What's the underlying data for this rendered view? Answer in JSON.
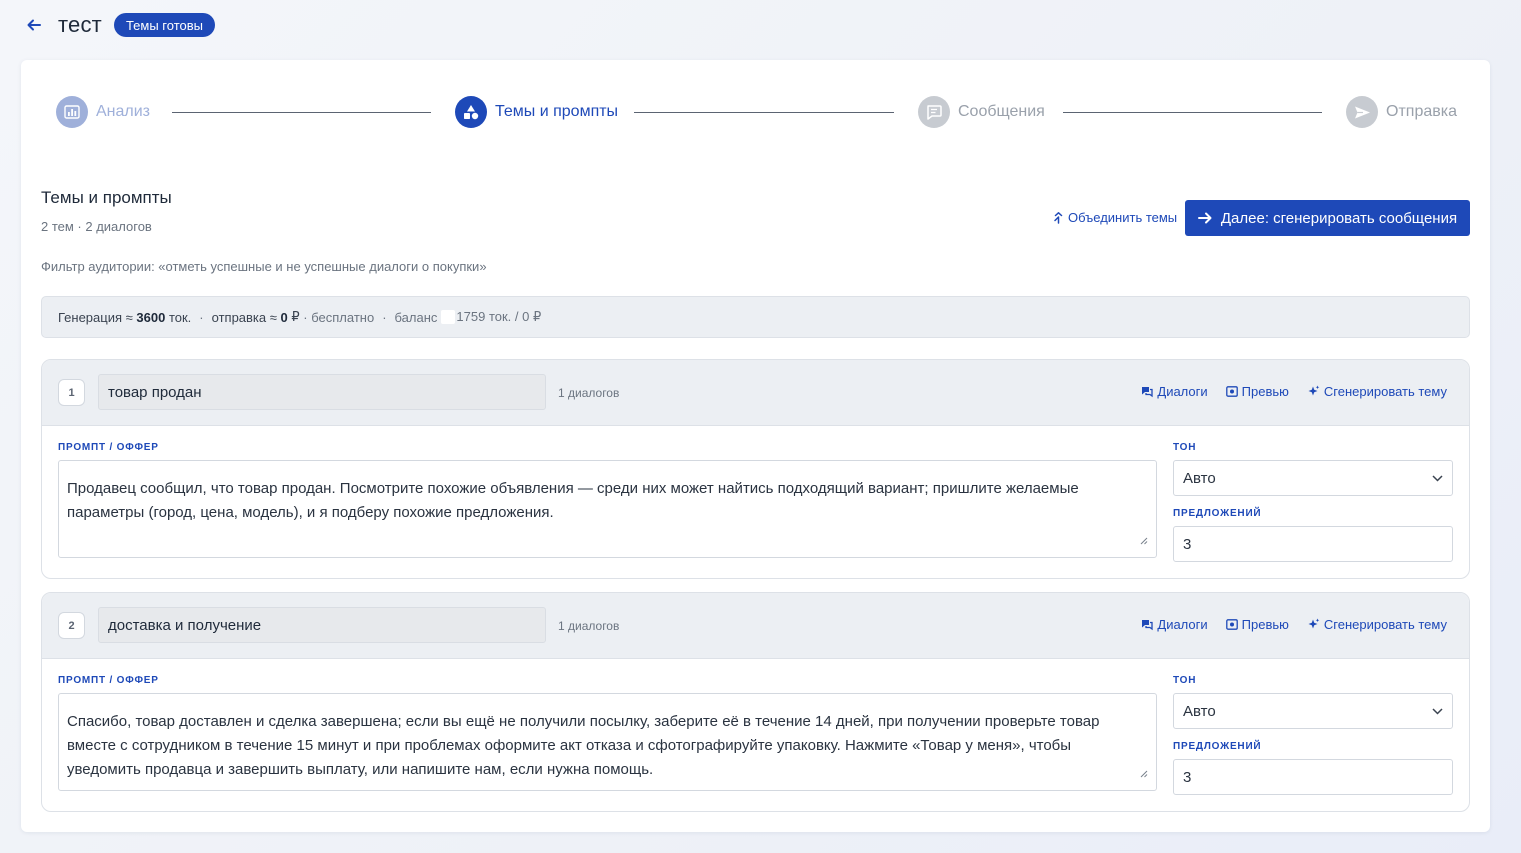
{
  "header": {
    "title": "тест",
    "status_badge": "Темы готовы"
  },
  "steps": [
    {
      "label": "Анализ",
      "state": "done"
    },
    {
      "label": "Темы и промпты",
      "state": "active"
    },
    {
      "label": "Сообщения",
      "state": "pending"
    },
    {
      "label": "Отправка",
      "state": "pending"
    }
  ],
  "section": {
    "title": "Темы и промпты",
    "subtitle": "2 тем · 2 диалогов",
    "filter": "Фильтр аудитории: «отметь успешные и не успешные диалоги о покупки»",
    "merge_label": "Объединить темы",
    "next_label": "Далее: сгенерировать сообщения"
  },
  "cost": {
    "gen_prefix": "Генерация ≈",
    "gen_value": "3600",
    "gen_unit": "ток.",
    "send_prefix": "отправка ≈",
    "send_value": "0",
    "send_unit": "₽",
    "free": "· бесплатно",
    "balance_label": "баланс",
    "balance_value": "1759 ток. / 0 ₽"
  },
  "labels": {
    "prompt": "ПРОМПТ / ОФФЕР",
    "tone": "ТОН",
    "sentences": "ПРЕДЛОЖЕНИЙ",
    "dialogs": "Диалоги",
    "preview": "Превью",
    "generate": "Сгенерировать тему"
  },
  "topics": [
    {
      "num": "1",
      "name": "товар продан",
      "count": "1 диалогов",
      "prompt": "Продавец сообщил, что товар продан. Посмотрите похожие объявления — среди них может найтись подходящий вариант; пришлите желаемые параметры (город, цена, модель), и я подберу похожие предложения.",
      "tone": "Авто",
      "sentences": "3"
    },
    {
      "num": "2",
      "name": "доставка и получение",
      "count": "1 диалогов",
      "prompt": "Спасибо, товар доставлен и сделка завершена; если вы ещё не получили посылку, заберите её в течение 14 дней, при получении проверьте товар вместе с сотрудником в течение 15 минут и при проблемах оформите акт отказа и сфотографируйте упаковку. Нажмите «Товар у меня», чтобы уведомить продавца и завершить выплату, или напишите нам, если нужна помощь.",
      "tone": "Авто",
      "sentences": "3"
    }
  ],
  "colors": {
    "accent": "#1e49b8",
    "done_step": "#9fb0da",
    "pending_step": "#c7cbd1"
  },
  "icons": {
    "back": "arrow-left-icon",
    "analysis": "bar-chart-icon",
    "topics": "shapes-icon",
    "messages": "chat-icon",
    "send": "paper-plane-icon",
    "merge": "merge-icon",
    "next": "arrow-right-icon",
    "dialogs": "chat-bubbles-icon",
    "preview": "eye-icon",
    "generate": "sparkle-icon",
    "chevron": "chevron-down-icon"
  }
}
